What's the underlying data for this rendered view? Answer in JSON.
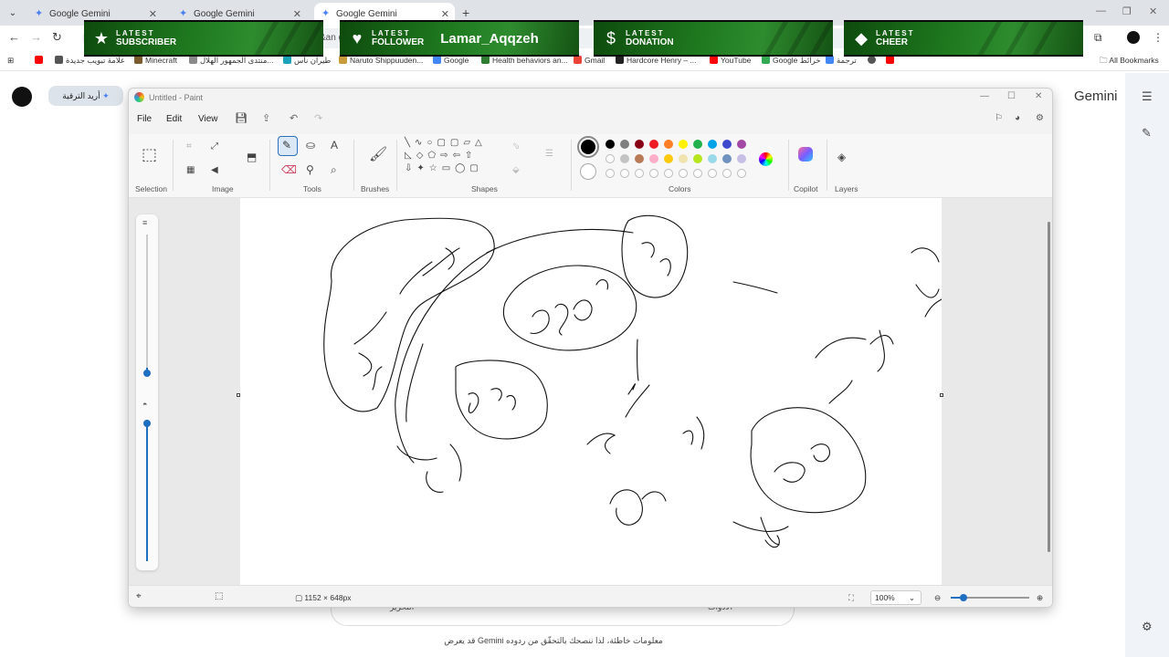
{
  "browser": {
    "tabs": [
      {
        "title": "Google Gemini",
        "active": false
      },
      {
        "title": "Google Gemini",
        "active": false
      },
      {
        "title": "Google Gemini",
        "active": true
      }
    ],
    "new_tab": "+",
    "omnibox_fragment": "&an                                                                                                                                   gn=",
    "bookmarks": [
      {
        "label": "علامة تبويب جديدة",
        "color": "#d0021b"
      },
      {
        "label": "Minecraft",
        "color": "#7a5b2e"
      },
      {
        "label": "منتدى الجمهور الهلال...",
        "color": "#8a8a8a"
      },
      {
        "label": "طيران ناس",
        "color": "#1aa3b8"
      },
      {
        "label": "Naruto Shippuuden...",
        "color": "#c79a3c"
      },
      {
        "label": "Google",
        "color": "#4285f4"
      },
      {
        "label": "Health behaviors an...",
        "color": "#2e7d32"
      },
      {
        "label": "Gmail",
        "color": "#ea4335"
      },
      {
        "label": "Hardcore Henry – ...",
        "color": "#222222"
      },
      {
        "label": "YouTube",
        "color": "#ff0000"
      },
      {
        "label": "Google خرائط",
        "color": "#34a853"
      },
      {
        "label": "ترجمة",
        "color": "#4285f4"
      },
      {
        "label": "",
        "color": "#555555"
      },
      {
        "label": "",
        "color": "#ff0000"
      }
    ],
    "all_bookmarks": "All Bookmarks"
  },
  "overlay": {
    "banners": [
      {
        "line1": "LATEST",
        "line2": "SUBSCRIBER",
        "name": "",
        "icon": "star-icon"
      },
      {
        "line1": "LATEST",
        "line2": "FOLLOWER",
        "name": "Lamar_Aqqzeh",
        "icon": "heart-icon"
      },
      {
        "line1": "LATEST",
        "line2": "DONATION",
        "name": "",
        "icon": "dollar-icon"
      },
      {
        "line1": "LATEST",
        "line2": "CHEER",
        "name": "",
        "icon": "diamond-icon"
      }
    ]
  },
  "gemini": {
    "upgrade_label": "أريد الترقية",
    "title": "Gemini",
    "input_left": "الأدوات",
    "input_right": "الأدوات",
    "input_left_text": "التحرير",
    "footer": "قد يعرض Gemini معلومات خاطئة، لذا ننصحك بالتحقّق من ردوده"
  },
  "paint": {
    "title": "Untitled - Paint",
    "menu": [
      "File",
      "Edit",
      "View"
    ],
    "groups": [
      "Selection",
      "Image",
      "Tools",
      "Brushes",
      "Shapes",
      "Colors",
      "Copilot",
      "Layers"
    ],
    "colors_row1": [
      "#000000",
      "#7f7f7f",
      "#880015",
      "#ed1c24",
      "#ff7f27",
      "#fff200",
      "#22b14c",
      "#00a2e8",
      "#3f48cc",
      "#a349a4"
    ],
    "colors_row2": [
      "#ffffff",
      "#c3c3c3",
      "#b97a57",
      "#ffaec9",
      "#ffc90e",
      "#efe4b0",
      "#b5e61d",
      "#99d9ea",
      "#7092be",
      "#c8bfe7"
    ],
    "canvas_size": "1152 × 648px",
    "zoom": "100%"
  }
}
